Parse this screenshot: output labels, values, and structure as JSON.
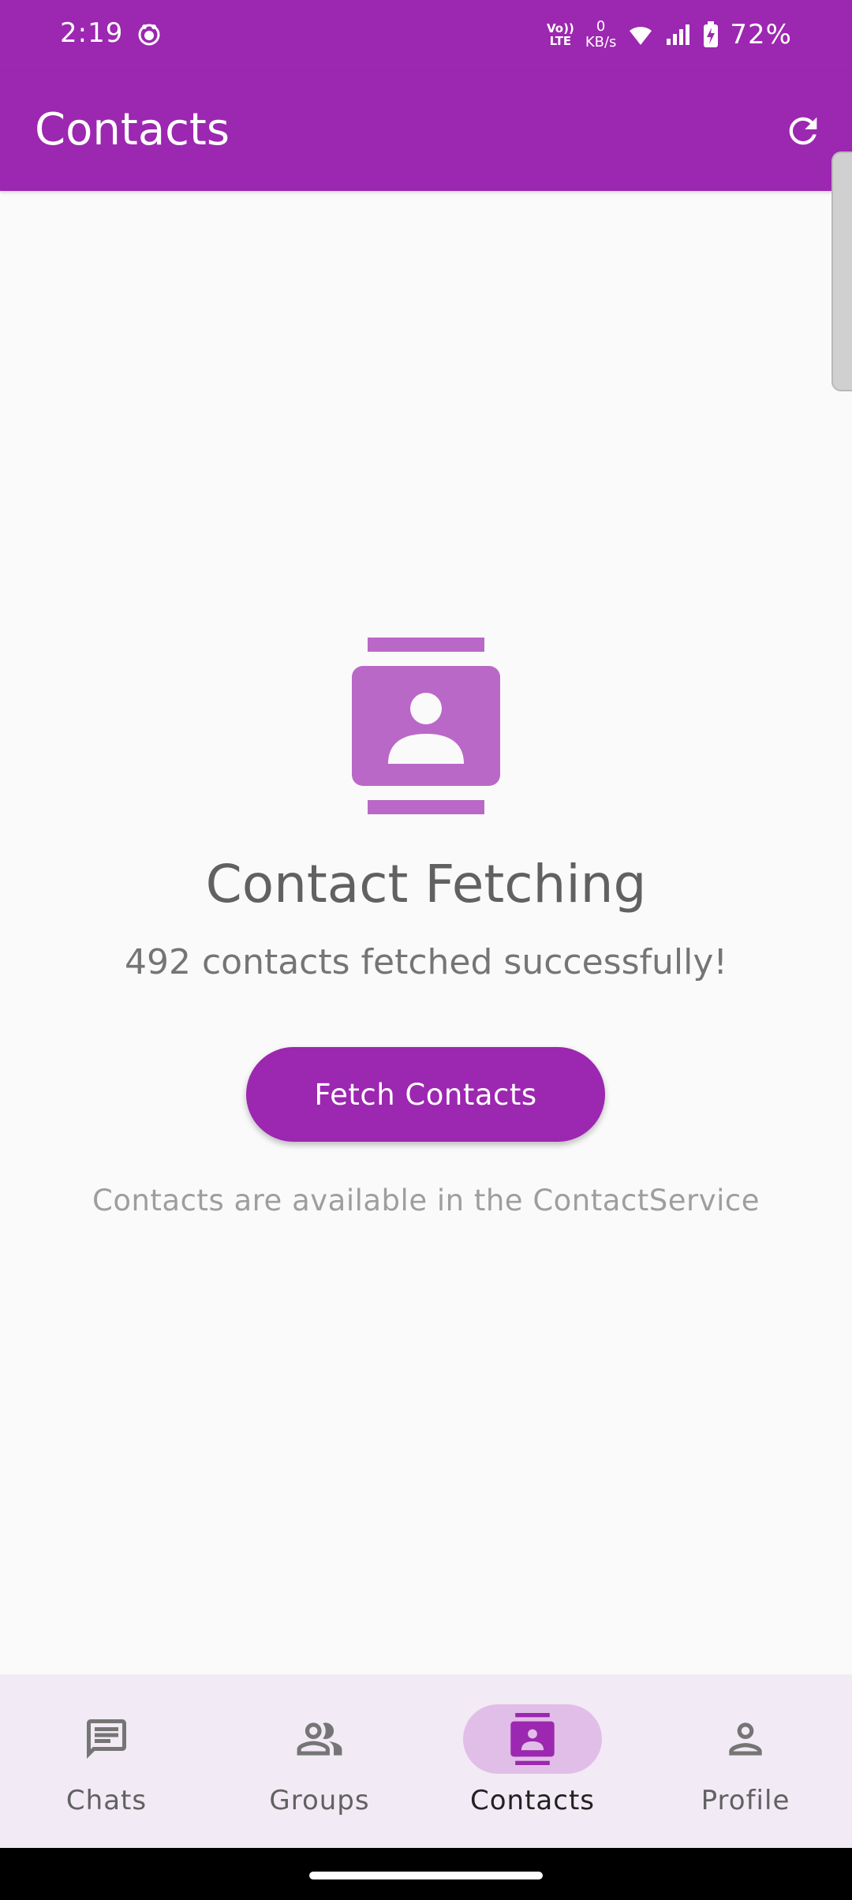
{
  "status_bar": {
    "time": "2:19",
    "volte_top": "Vo))",
    "volte_bottom": "LTE",
    "net_speed_value": "0",
    "net_speed_unit": "KB/s",
    "battery_percent": "72%"
  },
  "app_bar": {
    "title": "Contacts",
    "refresh_icon": "refresh-icon"
  },
  "main": {
    "icon": "contacts-book-icon",
    "heading": "Contact Fetching",
    "status_message": "492 contacts fetched successfully!",
    "fetch_button_label": "Fetch Contacts",
    "hint": "Contacts are available in the ContactService"
  },
  "bottom_nav": {
    "items": [
      {
        "label": "Chats",
        "icon": "chat-icon",
        "active": false
      },
      {
        "label": "Groups",
        "icon": "groups-icon",
        "active": false
      },
      {
        "label": "Contacts",
        "icon": "contacts-icon",
        "active": true
      },
      {
        "label": "Profile",
        "icon": "person-icon",
        "active": false
      }
    ]
  },
  "colors": {
    "primary": "#9c27b0",
    "primary_light": "#ba68c8",
    "active_indicator": "#e1bee7",
    "nav_background": "#f2eaf4",
    "text_dark": "#616161",
    "text_hint": "#9e9e9e"
  }
}
